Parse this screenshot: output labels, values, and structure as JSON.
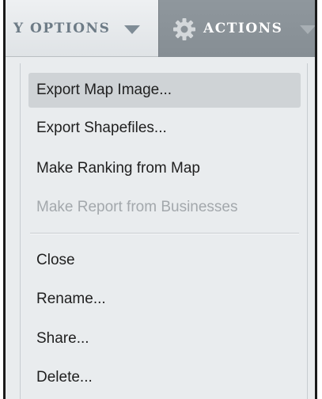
{
  "toolbar": {
    "view_options_label": "Y OPTIONS",
    "actions_label": "ACTIONS"
  },
  "menu": {
    "group1": [
      {
        "label": "Export Map Image...",
        "state": "highlighted"
      },
      {
        "label": "Export Shapefiles...",
        "state": "normal"
      },
      {
        "label": "Make Ranking from Map",
        "state": "normal"
      },
      {
        "label": "Make Report from Businesses",
        "state": "disabled"
      }
    ],
    "group2": [
      {
        "label": "Close",
        "state": "normal"
      },
      {
        "label": "Rename...",
        "state": "normal"
      },
      {
        "label": "Share...",
        "state": "normal"
      },
      {
        "label": "Delete...",
        "state": "normal"
      }
    ]
  },
  "icons": {
    "view_options_caret": "chevron-down-icon",
    "actions_gear": "gear-icon",
    "actions_caret": "chevron-down-icon"
  },
  "colors": {
    "actions_button_bg": "#8b9399",
    "menu_bg": "#e9ecee",
    "highlight_bg": "#cfd3d6",
    "disabled_text": "#a3a8ac"
  }
}
